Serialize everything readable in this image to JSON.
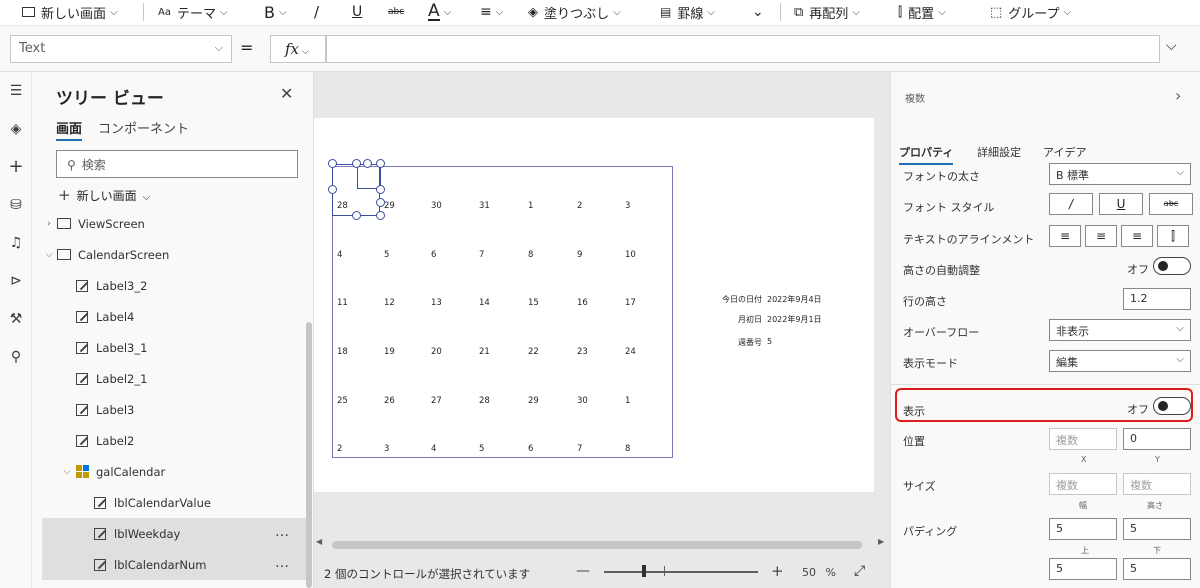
{
  "toolbar": {
    "new_screen": "新しい画面",
    "theme": "テーマ",
    "bold": "B",
    "italic": "/",
    "underline": "U",
    "strike": "abc",
    "font_color": "A",
    "fill": "塗りつぶし",
    "border": "罫線",
    "reorder": "再配列",
    "align": "配置",
    "group": "グループ"
  },
  "formula": {
    "property": "Text",
    "equals": "=",
    "fx": "fx",
    "value": ""
  },
  "tree": {
    "title": "ツリー ビュー",
    "tabs": [
      "画面",
      "コンポーネント"
    ],
    "search_placeholder": "検索",
    "new_screen": "新しい画面",
    "nodes": [
      {
        "label": "ViewScreen",
        "icon": "screen-icon",
        "level": 0,
        "expander": "right"
      },
      {
        "label": "CalendarScreen",
        "icon": "screen-icon",
        "level": 0,
        "expander": "down"
      },
      {
        "label": "Label3_2",
        "icon": "label-icon",
        "level": 1
      },
      {
        "label": "Label4",
        "icon": "label-icon",
        "level": 1
      },
      {
        "label": "Label3_1",
        "icon": "label-icon",
        "level": 1
      },
      {
        "label": "Label2_1",
        "icon": "label-icon",
        "level": 1
      },
      {
        "label": "Label3",
        "icon": "label-icon",
        "level": 1
      },
      {
        "label": "Label2",
        "icon": "label-icon",
        "level": 1
      },
      {
        "label": "galCalendar",
        "icon": "gallery-icon",
        "level": 1,
        "expander": "down"
      },
      {
        "label": "lblCalendarValue",
        "icon": "label-icon",
        "level": 2
      },
      {
        "label": "lblWeekday",
        "icon": "label-icon",
        "level": 2,
        "selected": true,
        "more": "…"
      },
      {
        "label": "lblCalendarNum",
        "icon": "label-icon",
        "level": 2,
        "selected": true,
        "more": "…"
      }
    ]
  },
  "calendar": {
    "rows": [
      [
        "28",
        "29",
        "30",
        "31",
        "1",
        "2",
        "3"
      ],
      [
        "4",
        "5",
        "6",
        "7",
        "8",
        "9",
        "10"
      ],
      [
        "11",
        "12",
        "13",
        "14",
        "15",
        "16",
        "17"
      ],
      [
        "18",
        "19",
        "20",
        "21",
        "22",
        "23",
        "24"
      ],
      [
        "25",
        "26",
        "27",
        "28",
        "29",
        "30",
        "1"
      ],
      [
        "2",
        "3",
        "4",
        "5",
        "6",
        "7",
        "8"
      ]
    ]
  },
  "info": {
    "today_label": "今日の日付",
    "today_value": "2022年9月4日",
    "first_label": "月初日",
    "first_value": "2022年9月1日",
    "week_label": "週番号",
    "week_value": "5"
  },
  "status": {
    "text": "2 個のコントロールが選択されています",
    "zoom": "50 %",
    "zoom_level_percent": 50
  },
  "props": {
    "header": "複数",
    "tabs": [
      "プロパティ",
      "詳細設定",
      "アイデア"
    ],
    "font_weight_label": "フォントの太さ",
    "font_weight_value": "B  標準",
    "font_style_label": "フォント スタイル",
    "font_style_buttons": [
      "/",
      "U",
      "abc"
    ],
    "text_align_label": "テキストのアラインメント",
    "auto_height_label": "高さの自動調整",
    "auto_height_state": "オフ",
    "line_height_label": "行の高さ",
    "line_height_value": "1.2",
    "overflow_label": "オーバーフロー",
    "overflow_value": "非表示",
    "display_mode_label": "表示モード",
    "display_mode_value": "編集",
    "visible_label": "表示",
    "visible_state": "オフ",
    "position_label": "位置",
    "position_x": "複数",
    "position_y": "0",
    "x_label": "X",
    "y_label": "Y",
    "size_label": "サイズ",
    "size_w": "複数",
    "size_h": "複数",
    "w_label": "幅",
    "h_label": "高さ",
    "padding_label": "パディング",
    "padding_top": "5",
    "padding_bottom": "5",
    "top_label": "上",
    "bottom_label": "下",
    "padding_left": "5",
    "padding_right": "5"
  },
  "colors": {
    "accent": "#1e6fb6",
    "highlight": "#e01b1b",
    "selection": "#3a4fa0"
  }
}
